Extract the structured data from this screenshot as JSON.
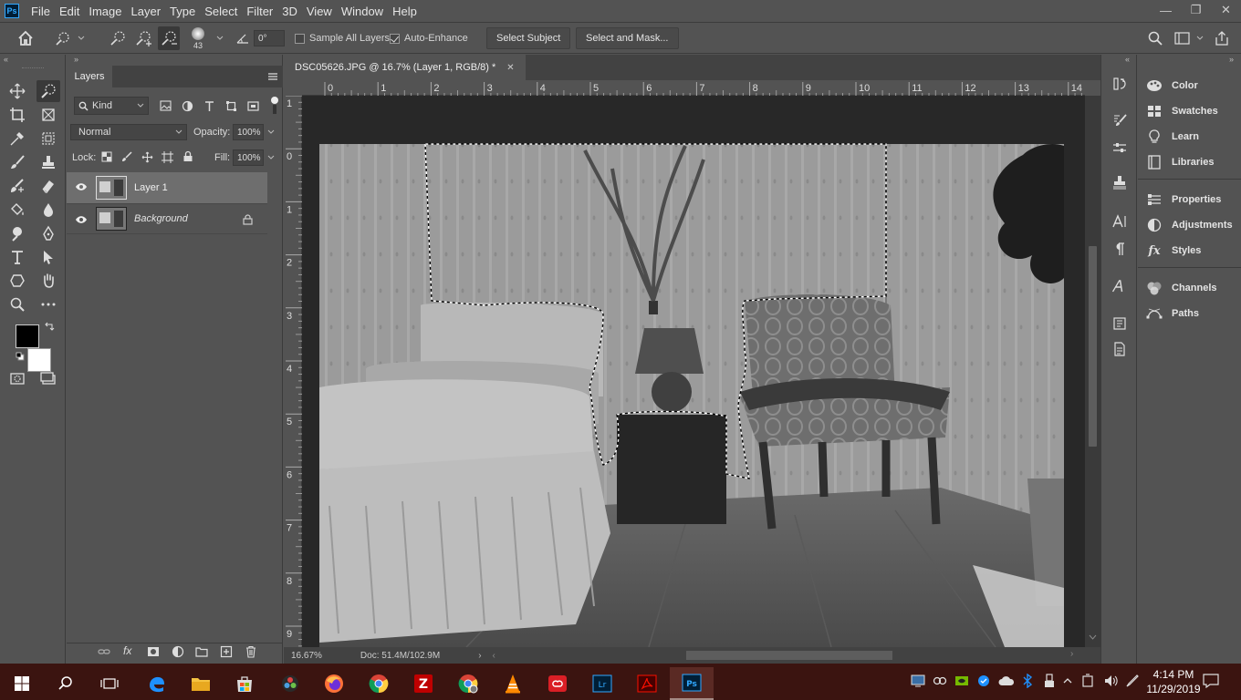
{
  "app": {
    "logo": "Ps"
  },
  "menu": [
    "File",
    "Edit",
    "Image",
    "Layer",
    "Type",
    "Select",
    "Filter",
    "3D",
    "View",
    "Window",
    "Help"
  ],
  "options": {
    "brush_size": "43",
    "angle": "0°",
    "sample_all_layers": "Sample All Layers",
    "auto_enhance": "Auto-Enhance",
    "select_subject": "Select Subject",
    "select_and_mask": "Select and Mask..."
  },
  "layers_panel": {
    "tab": "Layers",
    "filter_kind": "Kind",
    "blend_mode": "Normal",
    "opacity_label": "Opacity:",
    "opacity": "100%",
    "lock_label": "Lock:",
    "fill_label": "Fill:",
    "fill": "100%",
    "layers": [
      {
        "name": "Layer 1",
        "selected": true
      },
      {
        "name": "Background",
        "selected": false
      }
    ]
  },
  "document": {
    "tab_title": "DSC05626.JPG @ 16.7% (Layer 1, RGB/8) *",
    "zoom": "16.67%",
    "doc_size": "Doc: 51.4M/102.9M",
    "ruler_h": [
      "0",
      "1",
      "2",
      "3",
      "4",
      "5",
      "6",
      "7",
      "8",
      "9",
      "10",
      "11",
      "12",
      "13",
      "14"
    ],
    "ruler_v": [
      "1",
      "0",
      "1",
      "2",
      "3",
      "4",
      "5",
      "6",
      "7",
      "8",
      "9"
    ]
  },
  "right_panel": {
    "items": [
      {
        "label": "Color",
        "icon": "color-icon"
      },
      {
        "label": "Swatches",
        "icon": "swatches-icon"
      },
      {
        "label": "Learn",
        "icon": "learn-icon"
      },
      {
        "label": "Libraries",
        "icon": "libraries-icon"
      },
      {
        "label": "Properties",
        "icon": "properties-icon"
      },
      {
        "label": "Adjustments",
        "icon": "adjustments-icon"
      },
      {
        "label": "Styles",
        "icon": "styles-icon"
      },
      {
        "label": "Channels",
        "icon": "channels-icon"
      },
      {
        "label": "Paths",
        "icon": "paths-icon"
      }
    ]
  },
  "taskbar": {
    "time": "4:14 PM",
    "date": "11/29/2019"
  },
  "colors": {
    "ui_bg": "#535353",
    "dark_panel": "#424242",
    "canvas_bg": "#282828",
    "taskbar_bg": "#3b1410",
    "ps_blue": "#31a8ff"
  }
}
